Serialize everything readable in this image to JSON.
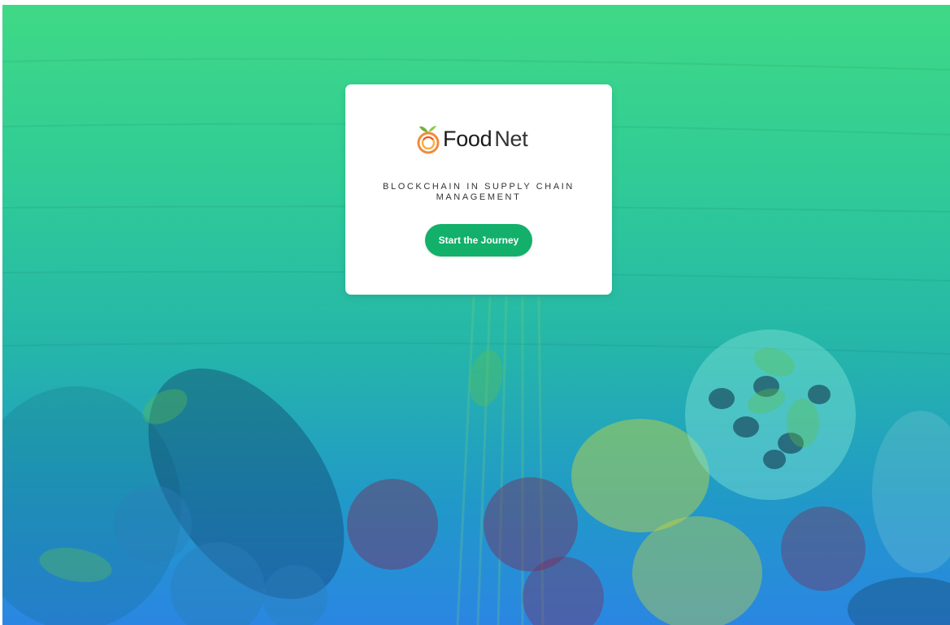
{
  "brand": {
    "name_part1": "Food",
    "name_part2": "Net",
    "logo_icon": "orange-fruit-icon"
  },
  "hero": {
    "tagline": "BLOCKCHAIN IN SUPPLY CHAIN MANAGEMENT",
    "cta_label": "Start the Journey"
  },
  "colors": {
    "gradient_top": "#3fd986",
    "gradient_bottom": "#2a86e2",
    "button": "#12b06a",
    "card": "#ffffff"
  }
}
